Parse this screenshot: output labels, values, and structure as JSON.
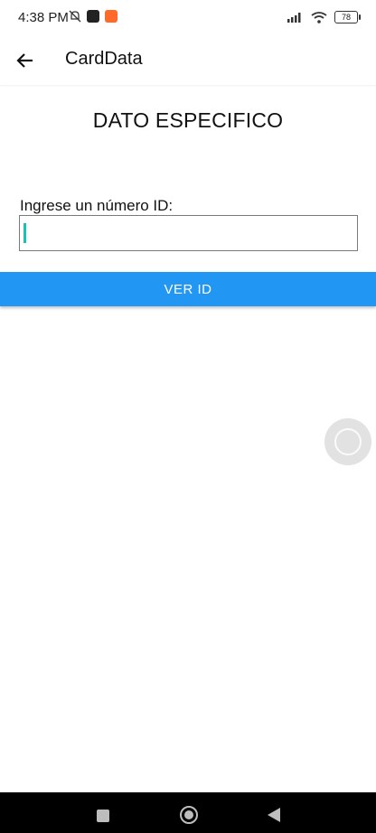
{
  "status_bar": {
    "time": "4:38 PM",
    "battery": "78",
    "icons": [
      "alarm-off-icon",
      "app-notification-icon",
      "recording-icon",
      "signal-icon",
      "wifi-icon",
      "battery-icon"
    ]
  },
  "app_bar": {
    "title": "CardData",
    "back_icon": "arrow-left-icon"
  },
  "main": {
    "heading": "DATO ESPECIFICO",
    "id_label": "Ingrese un número ID:",
    "id_value": "",
    "id_placeholder": "",
    "button_label": "VER ID"
  },
  "colors": {
    "accent": "#2196f3",
    "caret": "#19c2b8",
    "nav_bar": "#000000"
  },
  "nav_bar": {
    "icons": [
      "recents-icon",
      "home-icon",
      "back-icon"
    ]
  }
}
